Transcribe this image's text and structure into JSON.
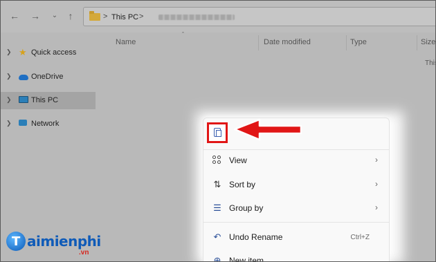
{
  "address_bar": {
    "crumb": "This PC",
    "separator": ">"
  },
  "columns": {
    "name": "Name",
    "date_modified": "Date modified",
    "type": "Type",
    "size": "Size"
  },
  "content": {
    "partial_text": "This"
  },
  "sidebar": {
    "items": [
      {
        "label": "Quick access",
        "icon": "star-icon"
      },
      {
        "label": "OneDrive",
        "icon": "cloud-icon"
      },
      {
        "label": "This PC",
        "icon": "monitor-icon",
        "selected": true
      },
      {
        "label": "Network",
        "icon": "network-icon"
      }
    ]
  },
  "context_menu": {
    "top_icons": [
      "paste-icon"
    ],
    "items": [
      {
        "label": "View",
        "icon": "view-grid-icon",
        "has_submenu": true
      },
      {
        "label": "Sort by",
        "icon": "sort-icon",
        "has_submenu": true
      },
      {
        "label": "Group by",
        "icon": "group-icon",
        "has_submenu": true
      },
      {
        "label": "Undo Rename",
        "icon": "undo-icon",
        "shortcut": "Ctrl+Z"
      },
      {
        "label": "New item",
        "icon": "add-icon"
      }
    ]
  },
  "annotation": {
    "highlight_color": "#e11616"
  },
  "watermark": {
    "initial": "T",
    "text": "aimienphi",
    "suffix": ".vn"
  }
}
